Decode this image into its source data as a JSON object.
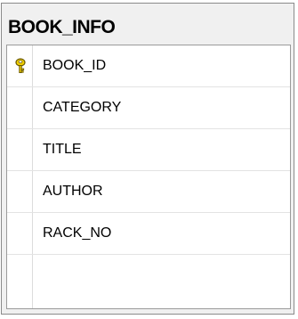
{
  "table": {
    "title": "BOOK_INFO",
    "columns": [
      {
        "name": "BOOK_ID",
        "primary_key": true,
        "icon": "primary-key-icon"
      },
      {
        "name": "CATEGORY",
        "primary_key": false
      },
      {
        "name": "TITLE",
        "primary_key": false
      },
      {
        "name": "AUTHOR",
        "primary_key": false
      },
      {
        "name": "RACK_NO",
        "primary_key": false
      }
    ]
  },
  "colors": {
    "key_gold": "#e8c200",
    "border": "#8a8a8a",
    "header_bg": "#f0f0f0"
  }
}
